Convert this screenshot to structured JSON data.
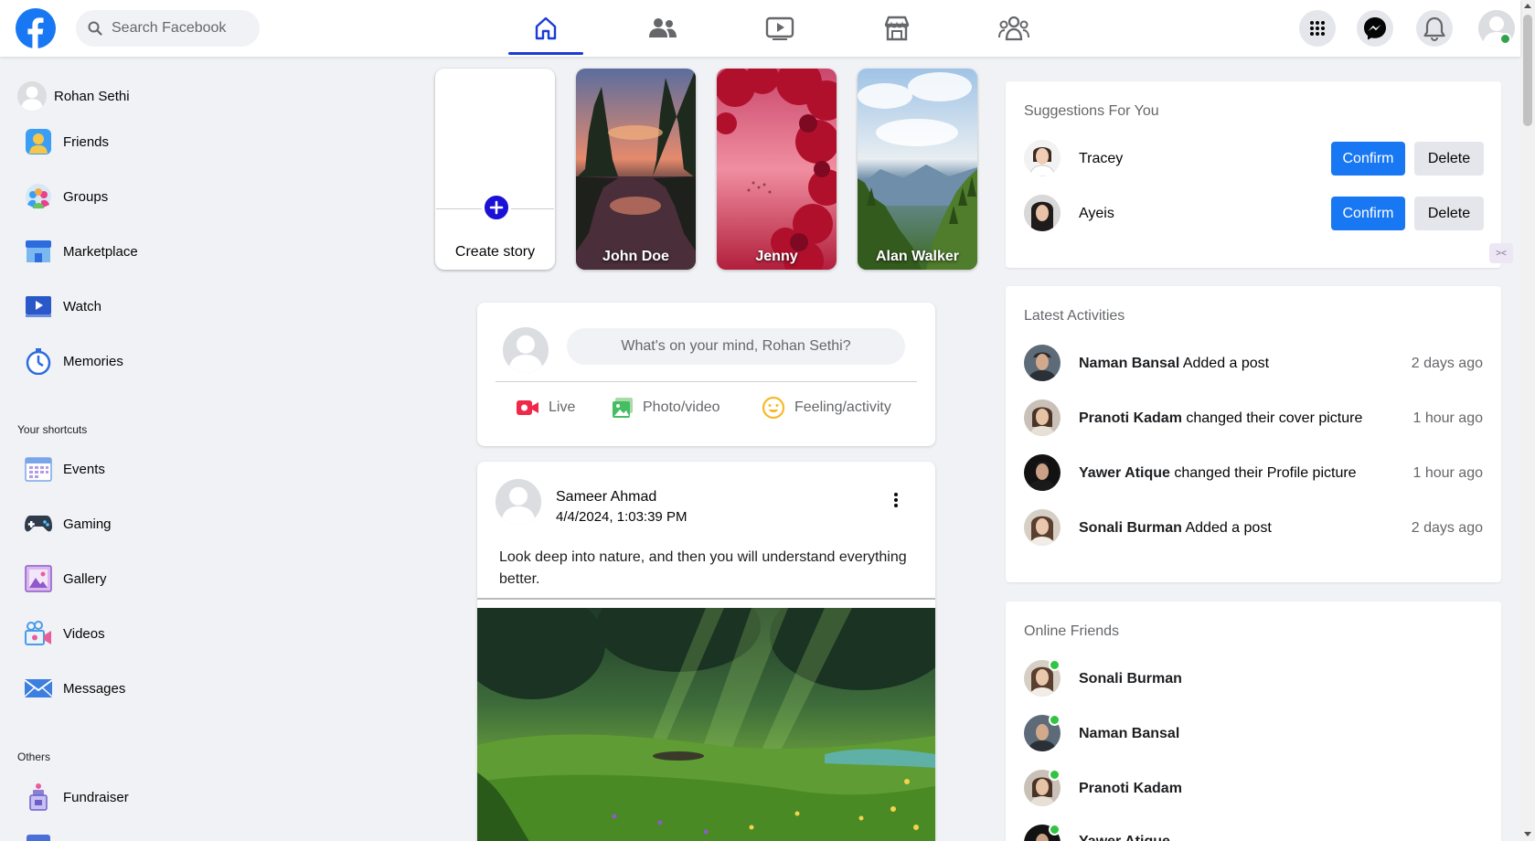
{
  "topbar": {
    "search_placeholder": "Search Facebook",
    "tabs": [
      "home-icon",
      "friends-icon",
      "watch-icon",
      "marketplace-icon",
      "groups-icon"
    ],
    "active_tab": "home",
    "accent": "#1b3bd6"
  },
  "left": {
    "profile_name": "Rohan Sethi",
    "items": [
      {
        "label": "Friends",
        "icon": "friends-icon"
      },
      {
        "label": "Groups",
        "icon": "groups-icon"
      },
      {
        "label": "Marketplace",
        "icon": "marketplace-icon"
      },
      {
        "label": "Watch",
        "icon": "watch-icon"
      },
      {
        "label": "Memories",
        "icon": "memories-icon"
      }
    ],
    "shortcuts_title": "Your shortcuts",
    "shortcuts": [
      {
        "label": "Events",
        "icon": "events-icon"
      },
      {
        "label": "Gaming",
        "icon": "gaming-icon"
      },
      {
        "label": "Gallery",
        "icon": "gallery-icon"
      },
      {
        "label": "Videos",
        "icon": "videos-icon"
      },
      {
        "label": "Messages",
        "icon": "messages-icon"
      }
    ],
    "others_title": "Others",
    "others": [
      {
        "label": "Fundraiser",
        "icon": "fundraiser-icon"
      }
    ]
  },
  "stories": {
    "create_label": "Create story",
    "items": [
      {
        "name": "John Doe"
      },
      {
        "name": "Jenny"
      },
      {
        "name": "Alan Walker"
      }
    ]
  },
  "composer": {
    "placeholder": "What's on your mind, Rohan Sethi?",
    "live": "Live",
    "photo": "Photo/video",
    "feeling": "Feeling/activity"
  },
  "post": {
    "author": "Sameer Ahmad",
    "time": "4/4/2024, 1:03:39 PM",
    "text": "Look deep into nature, and then you will understand everything better."
  },
  "suggestions": {
    "title": "Suggestions For You",
    "confirm": "Confirm",
    "delete": "Delete",
    "people": [
      {
        "name": "Tracey"
      },
      {
        "name": "Ayeis"
      }
    ]
  },
  "activities": {
    "title": "Latest Activities",
    "items": [
      {
        "name": "Naman Bansal",
        "action": "Added a post",
        "time": "2 days ago"
      },
      {
        "name": "Pranoti Kadam",
        "action": "changed their cover picture",
        "time": "1 hour ago"
      },
      {
        "name": "Yawer Atique",
        "action": "changed their Profile picture",
        "time": "1 hour ago"
      },
      {
        "name": "Sonali Burman",
        "action": "Added a post",
        "time": "2 days ago"
      }
    ]
  },
  "online": {
    "title": "Online Friends",
    "items": [
      {
        "name": "Sonali Burman"
      },
      {
        "name": "Naman Bansal"
      },
      {
        "name": "Pranoti Kadam"
      },
      {
        "name": "Yawer Atique"
      }
    ]
  }
}
